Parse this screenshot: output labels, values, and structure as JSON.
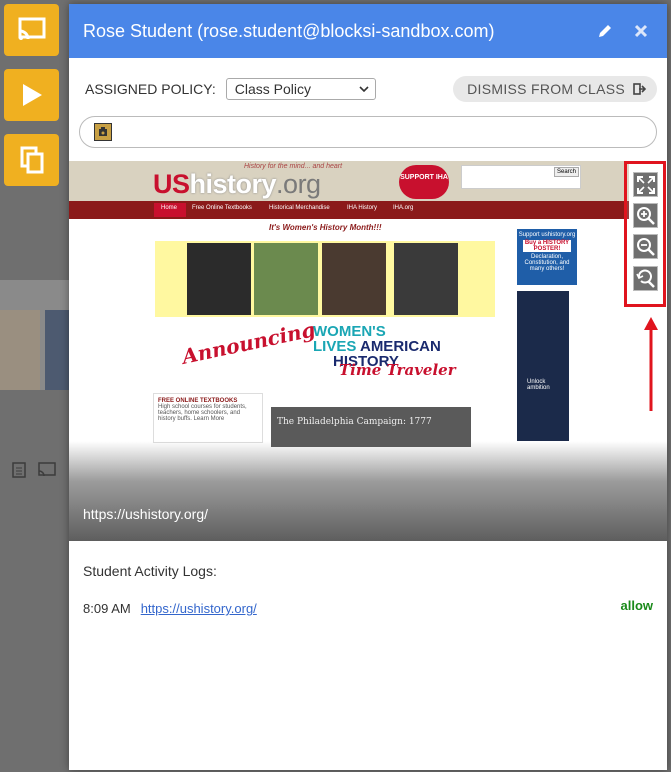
{
  "modal": {
    "title": "Rose Student (rose.student@blocksi-sandbox.com)",
    "edit_icon": "pencil-icon",
    "close_icon": "close-icon"
  },
  "policy": {
    "label": "ASSIGNED POLICY:",
    "selected": "Class Policy",
    "dismiss_label": "DISMISS FROM CLASS",
    "dismiss_icon": "exit-icon"
  },
  "screenshot": {
    "url": "https://ushistory.org/",
    "zoom_controls": [
      "fullscreen-icon",
      "zoom-in-icon",
      "zoom-out-icon",
      "zoom-reset-icon"
    ],
    "site": {
      "logo_us": "US",
      "logo_history": "history",
      "logo_org": ".org",
      "tagline": "History for the mind... and heart",
      "badge": "SUPPORT IHA",
      "search_button": "Search",
      "nav": [
        "Home",
        "Free Online Textbooks",
        "Historical Merchandise",
        "IHA History",
        "IHA.org"
      ],
      "banner": "It's Women's History Month!!!",
      "announce": "Announcing",
      "wl_line1": "WOMEN'S",
      "wl_line2a": "LIVES",
      "wl_line2b": "AMERICAN",
      "wl_line3": "HISTORY",
      "time_traveler": "Time Traveler",
      "textbook_title": "FREE ONLINE TEXTBOOKS",
      "textbook_body": "High school courses for students, teachers, home schoolers, and history buffs. Learn More",
      "philly": "The Philadelphia Campaign: 1777",
      "ad_title": "Support ushistory.org",
      "ad_line1": "Buy a HISTORY POSTER!",
      "ad_line2": "Declaration, Constitution, and many others!",
      "ad2_text": "Unlock ambition"
    }
  },
  "logs": {
    "title": "Student Activity Logs:",
    "entries": [
      {
        "time": "8:09 AM",
        "url": "https://ushistory.org/",
        "status": "allow"
      }
    ]
  },
  "colors": {
    "header": "#4a86e8",
    "accent_side": "#f0b020",
    "highlight": "#e0141e",
    "allow": "#1a8a1a"
  }
}
